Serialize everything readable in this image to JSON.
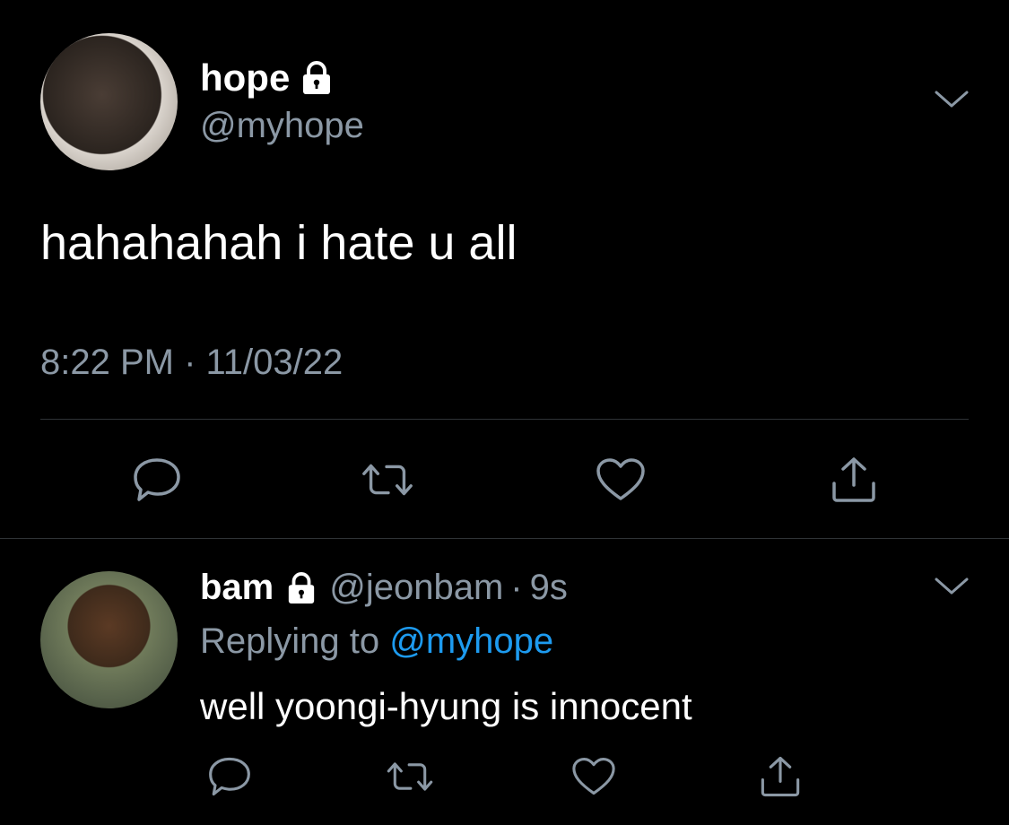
{
  "main_tweet": {
    "display_name": "hope",
    "handle": "@myhope",
    "text": "hahahahah i hate u all",
    "timestamp": "8:22 PM · 11/03/22",
    "icons": [
      "lock-icon",
      "chevron-down-icon",
      "reply-icon",
      "retweet-icon",
      "like-icon",
      "share-icon"
    ]
  },
  "reply_tweet": {
    "display_name": "bam",
    "handle": "@jeonbam",
    "separator": "·",
    "time": "9s",
    "replying_to_prefix": "Replying to",
    "replying_to_mention": "@myhope",
    "text": "well yoongi-hyung is innocent",
    "icons": [
      "lock-icon",
      "chevron-down-icon",
      "reply-icon",
      "retweet-icon",
      "like-icon",
      "share-icon"
    ]
  },
  "colors": {
    "background": "#000000",
    "primary_text": "#ffffff",
    "secondary_text": "#8b98a5",
    "accent": "#1d9bf0",
    "divider": "#2f3336"
  }
}
